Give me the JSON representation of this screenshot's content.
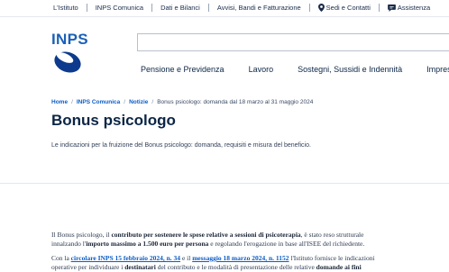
{
  "topbar": {
    "items": [
      "L'Istituto",
      "INPS Comunica",
      "Dati e Bilanci",
      "Avvisi, Bandi e Fatturazione",
      "Sedi e Contatti",
      "Assistenza"
    ]
  },
  "logo": {
    "text": "INPS"
  },
  "search": {
    "placeholder": ""
  },
  "mainnav": {
    "items": [
      "Pensione e Previdenza",
      "Lavoro",
      "Sostegni, Sussidi e Indennità",
      "Imprese e L"
    ]
  },
  "breadcrumb": {
    "home": "Home",
    "comunica": "INPS Comunica",
    "notizie": "Notizie",
    "current": "Bonus psicologo: domanda dal 18 marzo al 31 maggio 2024"
  },
  "page": {
    "title": "Bonus psicologo",
    "subtitle": "Le indicazioni per la fruizione del Bonus psicologo: domanda, requisiti e misura del beneficio."
  },
  "article": {
    "p1_l1_a": "Il Bonus psicologo, il ",
    "p1_l1_b": "contributo per sostenere le spese relative a sessioni di psicoterapia",
    "p1_l1_c": ", è stato reso strutturale",
    "p1_l2_a": "innalzando l'",
    "p1_l2_b": "importo massimo a 1.500 euro per persona",
    "p1_l2_c": " e regolando l'erogazione in base all'ISEE del richiedente.",
    "p2_l1_a": "Con la ",
    "p2_l1_link1": "circolare INPS 15 febbraio 2024, n. 34",
    "p2_l1_b": " e il ",
    "p2_l1_link2": "messaggio 18 marzo 2024, n. 1152",
    "p2_l1_c": " l'Istituto fornisce le indicazioni",
    "p2_l2_a": "operative per individuare i ",
    "p2_l2_b": "destinatari",
    "p2_l2_c": " del contributo e le modalità di presentazione delle relative ",
    "p2_l2_d": "domande ai fini"
  },
  "colors": {
    "brand": "#1b60b6",
    "link": "#0b5cc7",
    "heading": "#0b2545"
  },
  "icons": {
    "sedi": "map-pin-icon",
    "assistenza": "chat-icon"
  }
}
